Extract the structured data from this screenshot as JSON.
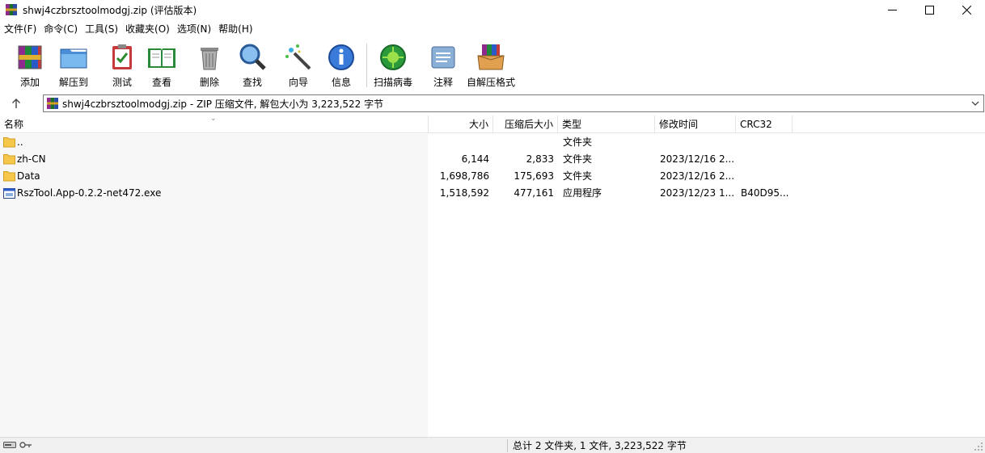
{
  "window": {
    "title": "shwj4czbrsztoolmodgj.zip (评估版本)"
  },
  "menu": [
    "文件(F)",
    "命令(C)",
    "工具(S)",
    "收藏夹(O)",
    "选项(N)",
    "帮助(H)"
  ],
  "toolbar": {
    "add": "添加",
    "extract": "解压到",
    "test": "测试",
    "view": "查看",
    "delete": "删除",
    "find": "查找",
    "wizard": "向导",
    "info": "信息",
    "scan": "扫描病毒",
    "comment": "注释",
    "sfx": "自解压格式"
  },
  "address": {
    "text": "shwj4czbrsztoolmodgj.zip - ZIP 压缩文件, 解包大小为 3,223,522 字节"
  },
  "columns": {
    "name": "名称",
    "size": "大小",
    "packed": "压缩后大小",
    "type": "类型",
    "modified": "修改时间",
    "crc": "CRC32"
  },
  "files": [
    {
      "name": "..",
      "size": "",
      "packed": "",
      "type": "文件夹",
      "modified": "",
      "crc": "",
      "icon": "folder-icon"
    },
    {
      "name": "zh-CN",
      "size": "6,144",
      "packed": "2,833",
      "type": "文件夹",
      "modified": "2023/12/16 2...",
      "crc": "",
      "icon": "folder-icon"
    },
    {
      "name": "Data",
      "size": "1,698,786",
      "packed": "175,693",
      "type": "文件夹",
      "modified": "2023/12/16 2...",
      "crc": "",
      "icon": "folder-icon"
    },
    {
      "name": "RszTool.App-0.2.2-net472.exe",
      "size": "1,518,592",
      "packed": "477,161",
      "type": "应用程序",
      "modified": "2023/12/23 1...",
      "crc": "B40D95...",
      "icon": "exe-icon"
    }
  ],
  "status": {
    "summary": "总计 2 文件夹, 1 文件, 3,223,522 字节"
  },
  "colors": {
    "folder": "#f5c84c",
    "border": "#e5e5e5",
    "statusbar": "#f0f0f0"
  }
}
